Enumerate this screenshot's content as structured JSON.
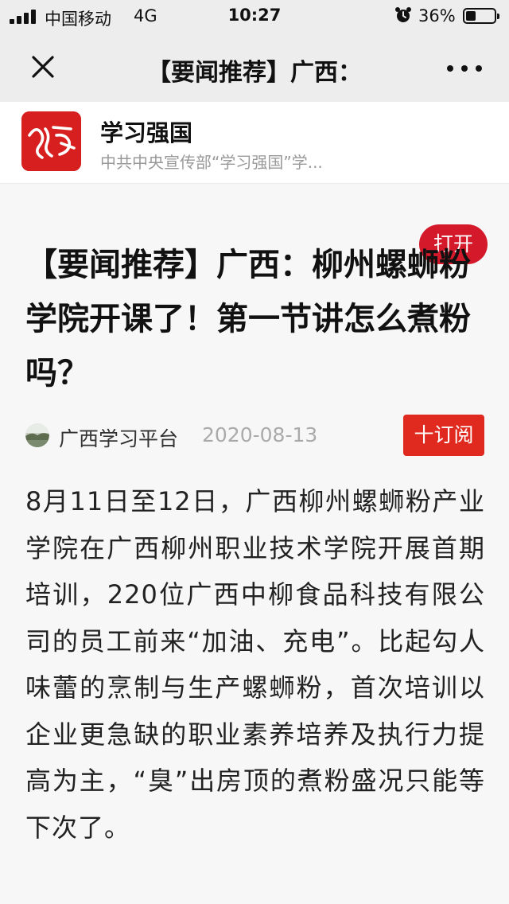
{
  "status_bar": {
    "carrier": "中国移动",
    "network": "4G",
    "time": "10:27",
    "battery_percent": "36%",
    "battery_level": 0.36
  },
  "nav": {
    "title": "【要闻推荐】广西：",
    "close_icon": "close-icon",
    "more_icon": "more-icon"
  },
  "app_banner": {
    "app_name": "学习强国",
    "description": "中共中央宣传部“学习强国”学...",
    "open_label": "打开",
    "logo_icon": "xuexi-logo",
    "accent_color": "#d4192b"
  },
  "article": {
    "headline": "【要闻推荐】广西：柳州螺蛳粉学院开课了！第一节讲怎么煮粉吗？",
    "source": "广西学习平台",
    "date": "2020-08-13",
    "subscribe_label": "十订阅",
    "subscribe_color": "#e02a1f",
    "body": "8月11日至12日，广西柳州螺蛳粉产业学院在广西柳州职业技术学院开展首期培训，220位广西中柳食品科技有限公司的员工前来“加油、充电”。比起勾人味蕾的烹制与生产螺蛳粉，首次培训以企业更急缺的职业素养培养及执行力提高为主，“臭”出房顶的煮粉盛况只能等下次了。"
  }
}
